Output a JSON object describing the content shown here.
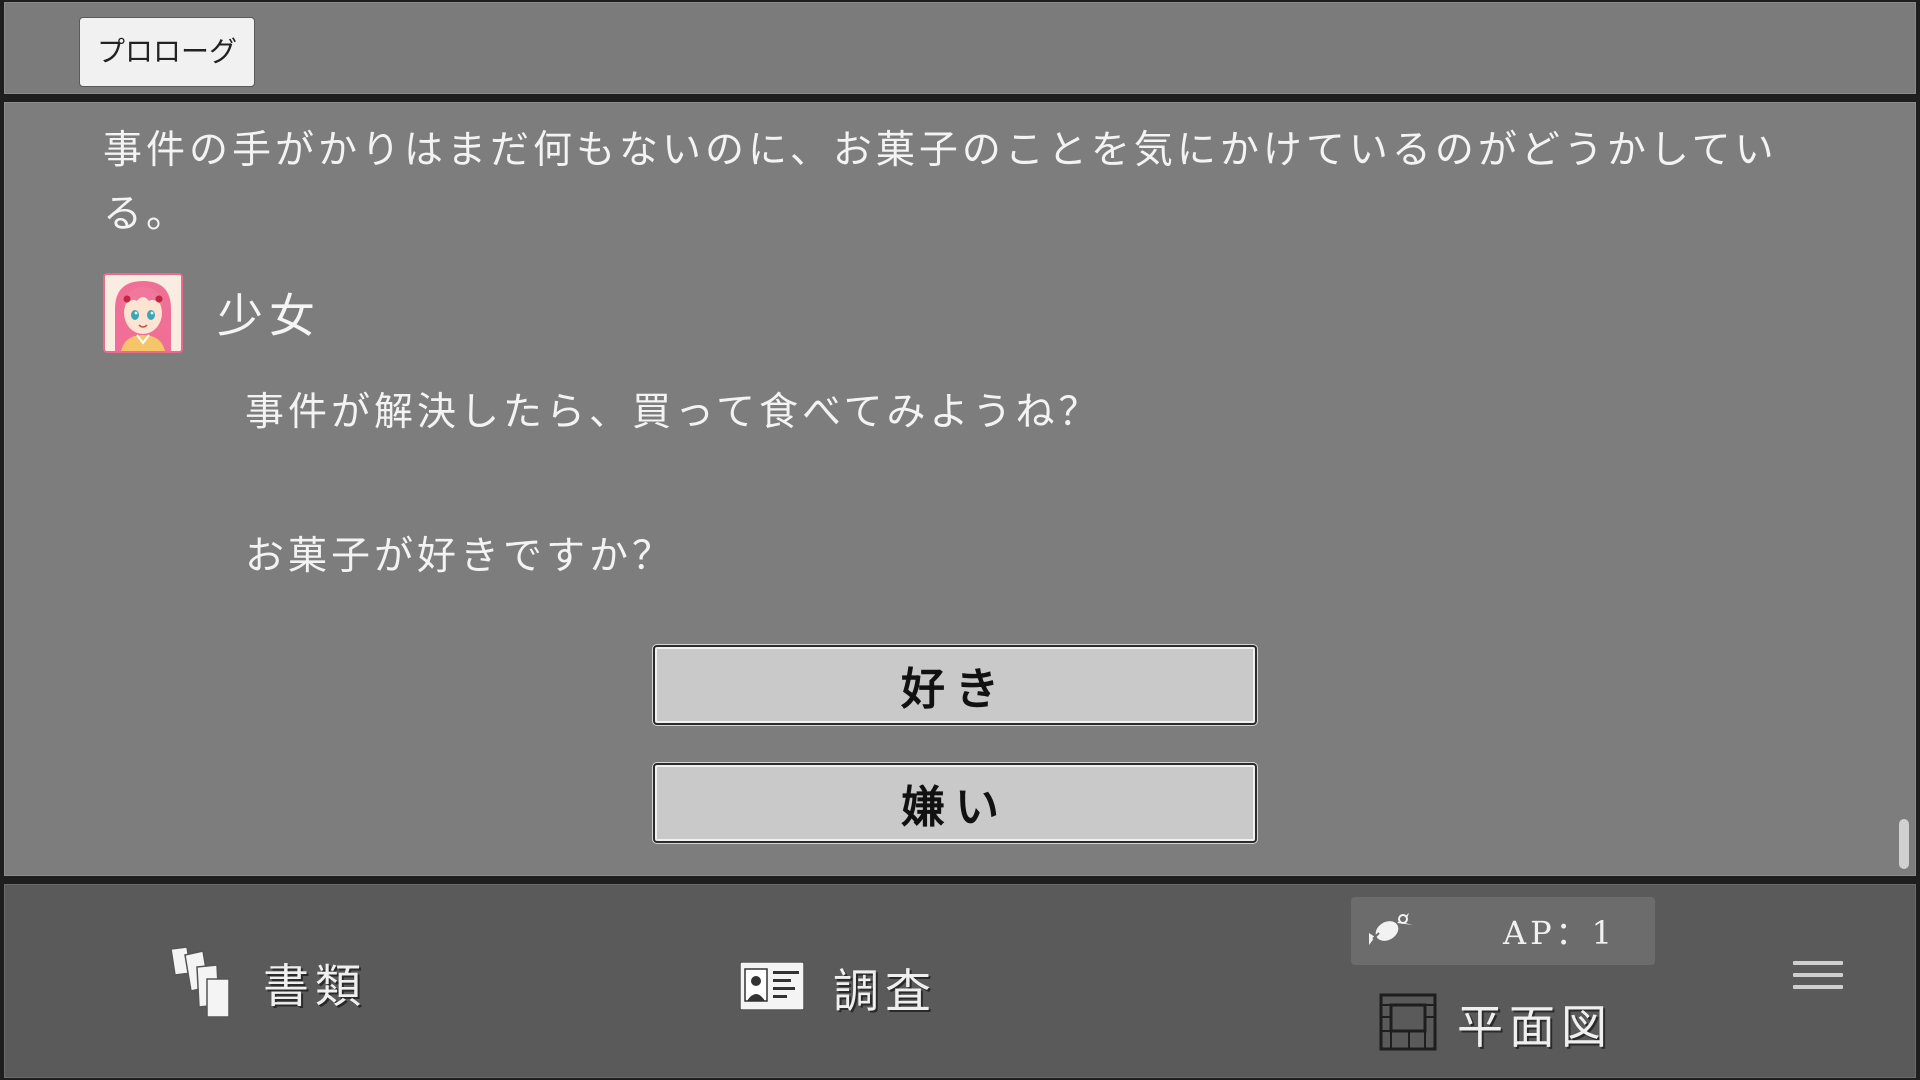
{
  "header": {
    "chapter_label": "プロローグ"
  },
  "log": {
    "narration": "事件の手がかりはまだ何もないのに、お菓子のことを気にかけているのがどうかしている。",
    "speaker_name": "少女",
    "speaker_avatar_icon": "girl-portrait-icon",
    "lines": [
      "事件が解決したら、買って食べてみようね？",
      "お菓子が好きですか？"
    ]
  },
  "choices": [
    {
      "label": "好き"
    },
    {
      "label": "嫌い"
    }
  ],
  "bottom_nav": {
    "documents_label": "書類",
    "documents_icon": "documents-icon",
    "investigate_label": "調査",
    "investigate_icon": "id-card-icon",
    "ap_text": "AP：1",
    "ap_icon": "candy-icon",
    "map_label": "平面図",
    "map_icon": "floor-plan-icon",
    "menu_icon": "hamburger-menu-icon"
  },
  "colors": {
    "background_panel": "#7d7d7d",
    "bottom_bar": "#5a5a5a",
    "choice_button": "#c9c9c9",
    "avatar_border": "#e86a8c"
  }
}
